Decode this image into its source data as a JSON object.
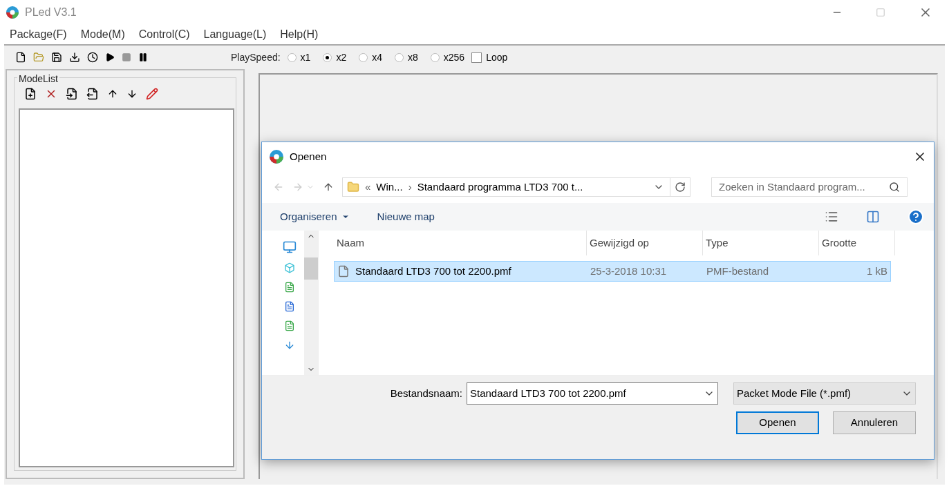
{
  "window": {
    "title": "PLed V3.1"
  },
  "menu": [
    "Package(F)",
    "Mode(M)",
    "Control(C)",
    "Language(L)",
    "Help(H)"
  ],
  "playspeed": {
    "label": "PlaySpeed:",
    "options": [
      {
        "label": "x1",
        "selected": false
      },
      {
        "label": "x2",
        "selected": true
      },
      {
        "label": "x4",
        "selected": false
      },
      {
        "label": "x8",
        "selected": false
      },
      {
        "label": "x256",
        "selected": false
      }
    ],
    "loop": {
      "label": "Loop",
      "checked": false
    }
  },
  "modelist": {
    "title": "ModeList"
  },
  "dialog": {
    "title": "Openen",
    "path": {
      "crumbs": [
        "«",
        "Win...",
        "›",
        "Standaard programma LTD3 700 t..."
      ]
    },
    "search": {
      "placeholder": "Zoeken in Standaard program..."
    },
    "commands": [
      "Organiseren",
      "Nieuwe map"
    ],
    "columns": [
      "Naam",
      "Gewijzigd op",
      "Type",
      "Grootte"
    ],
    "rows": [
      {
        "name": "Standaard LTD3 700 tot 2200.pmf",
        "modified": "25-3-2018 10:31",
        "type": "PMF-bestand",
        "size": "1 kB",
        "selected": true
      }
    ],
    "filename": {
      "label": "Bestandsnaam:",
      "value": "Standaard LTD3 700 tot 2200.pmf"
    },
    "filter": "Packet Mode File (*.pmf)",
    "buttons": [
      "Openen",
      "Annuleren"
    ]
  }
}
